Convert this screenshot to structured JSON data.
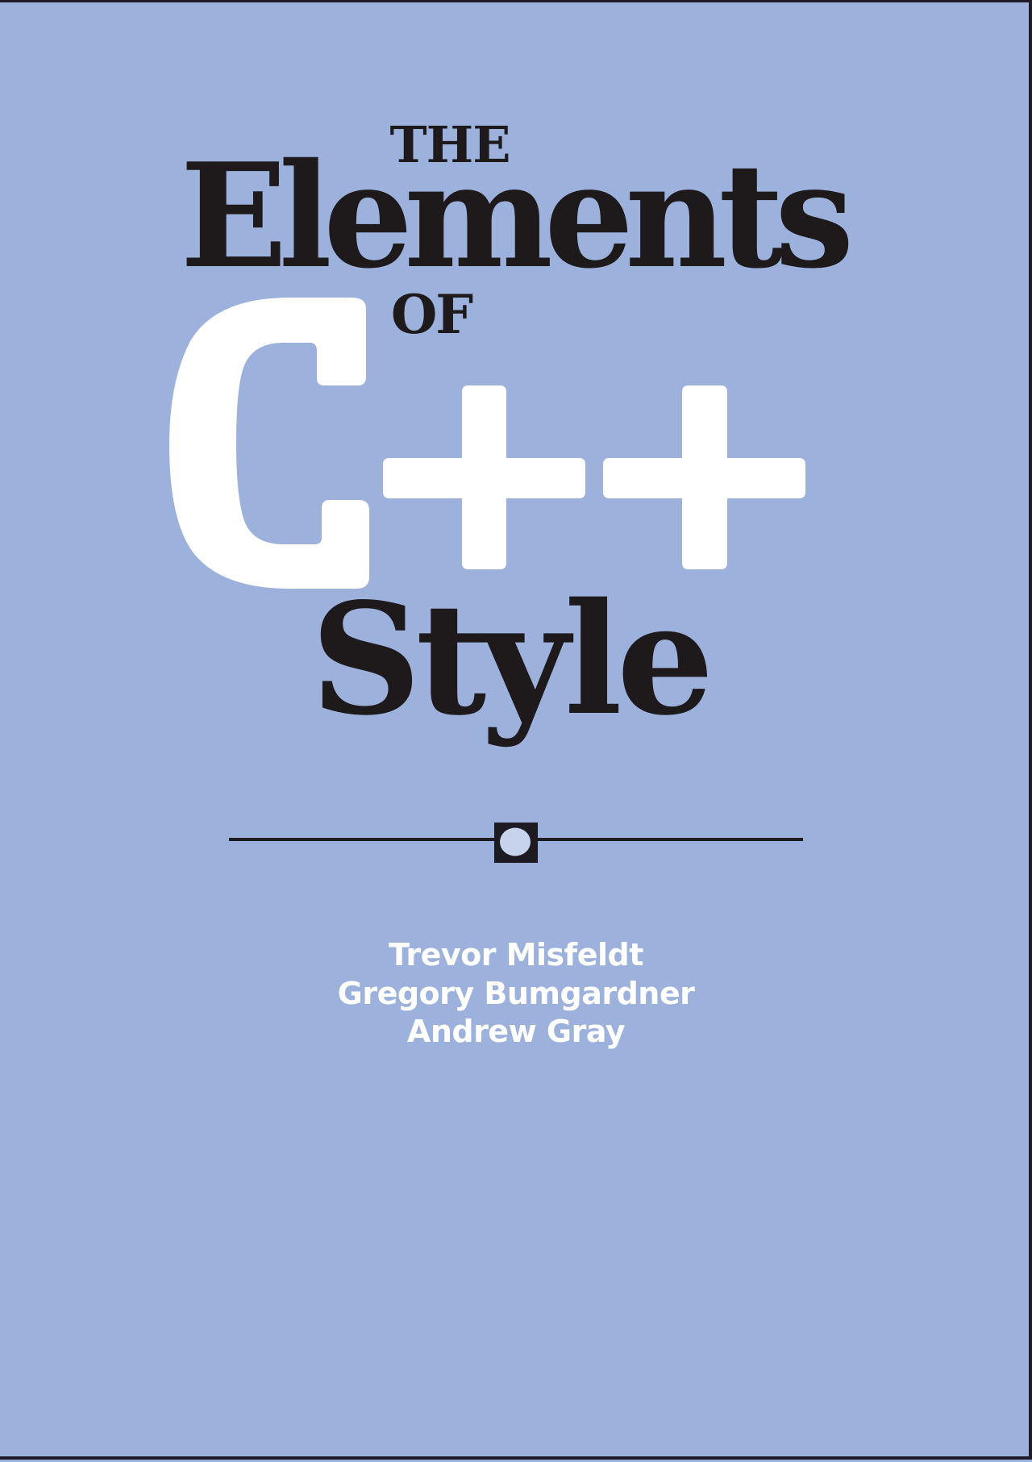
{
  "cover": {
    "title_line_1": "THE",
    "title_line_2": "Elements",
    "title_line_3": "OF",
    "title_language": "C++",
    "title_line_5": "Style",
    "authors": [
      "Trevor Misfeldt",
      "Gregory Bumgardner",
      "Andrew Gray"
    ],
    "divider_icon": "square-circle-ornament-icon",
    "colors": {
      "background": "#9db1dd",
      "title_text": "#1e1a1c",
      "language_text": "#ffffff",
      "author_text": "#ffffff",
      "border": "#1f1b27"
    }
  }
}
